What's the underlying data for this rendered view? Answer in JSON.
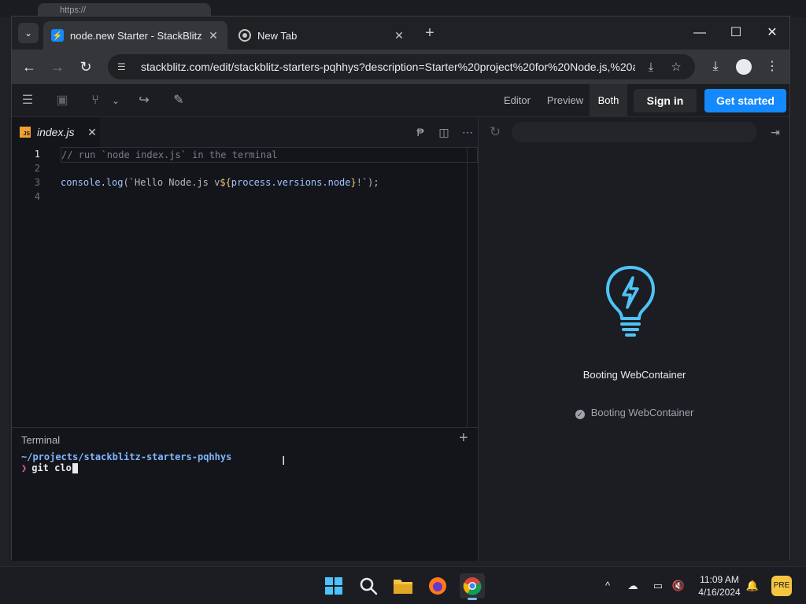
{
  "browser": {
    "background_tab_text": "https://",
    "tabs": [
      {
        "label": "node.new Starter - StackBlitz",
        "active": true
      },
      {
        "label": "New Tab",
        "active": false
      }
    ],
    "address": "stackblitz.com/edit/stackblitz-starters-pqhhys?description=Starter%20project%20for%20Node.js,%20a..."
  },
  "stackblitz": {
    "view_modes": [
      "Editor",
      "Preview",
      "Both"
    ],
    "active_view": "Both",
    "sign_in_label": "Sign in",
    "get_started_label": "Get started",
    "colors": {
      "accent": "#1389fd",
      "bulb": "#4fc3f7"
    }
  },
  "editor": {
    "file_tab": "index.js",
    "lines": [
      {
        "n": "1",
        "text": "// run `node index.js` in the terminal"
      },
      {
        "n": "2",
        "text": ""
      },
      {
        "n": "3",
        "parts": [
          "console",
          ".",
          "log",
          "(`Hello Node.js v",
          "${",
          "process.versions.node",
          "}",
          "!`);"
        ]
      },
      {
        "n": "4",
        "text": ""
      }
    ]
  },
  "terminal": {
    "title": "Terminal",
    "path": "~/projects/stackblitz-starters-pqhhys",
    "prompt": "❯",
    "command": "git clo"
  },
  "preview": {
    "boot_title": "Booting WebContainer",
    "boot_status": "Booting WebContainer"
  },
  "taskbar": {
    "time": "11:09 AM",
    "date": "4/16/2024"
  }
}
